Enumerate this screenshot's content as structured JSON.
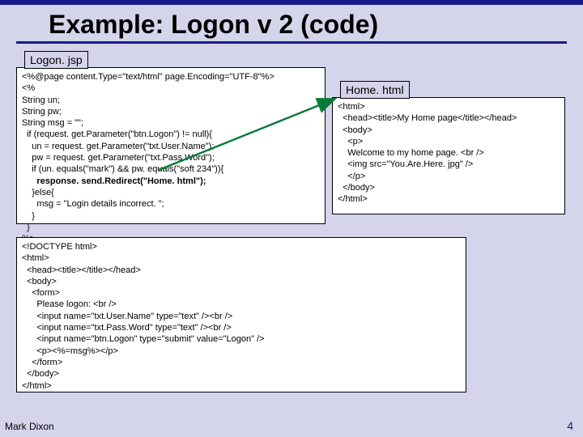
{
  "title": "Example: Logon v 2 (code)",
  "tabs": {
    "left": "Logon. jsp",
    "right": "Home. html"
  },
  "code": {
    "left1": "<%@page content.Type=\"text/html\" page.Encoding=\"UTF-8\"%>\n<%\nString un;\nString pw;\nString msg = \"\";\n  if (request. get.Parameter(\"btn.Logon\") != null){\n    un = request. get.Parameter(\"txt.User.Name\");\n    pw = request. get.Parameter(\"txt.Pass.Word\");\n    if (un. equals(\"mark\") && pw. equals(\"soft 234\")){",
    "left1_bold": "      response. send.Redirect(\"Home. html\");",
    "left1_after": "    }else{\n      msg = \"Login details incorrect. \";\n    }\n  }\n%>",
    "left2": "<!DOCTYPE html>\n<html>\n  <head><title></title></head>\n  <body>\n    <form>\n      Please logon: <br />\n      <input name=\"txt.User.Name\" type=\"text\" /><br />\n      <input name=\"txt.Pass.Word\" type=\"text\" /><br />\n      <input name=\"btn.Logon\" type=\"submit\" value=\"Logon\" />\n      <p><%=msg%></p>\n    </form>\n  </body>\n</html>",
    "right": "<html>\n  <head><title>My Home page</title></head>\n  <body>\n    <p>\n    Welcome to my home page. <br />\n    <img src=\"You.Are.Here. jpg\" />\n    </p>\n  </body>\n</html>"
  },
  "footer": {
    "left": "Mark Dixon",
    "right": "4"
  }
}
